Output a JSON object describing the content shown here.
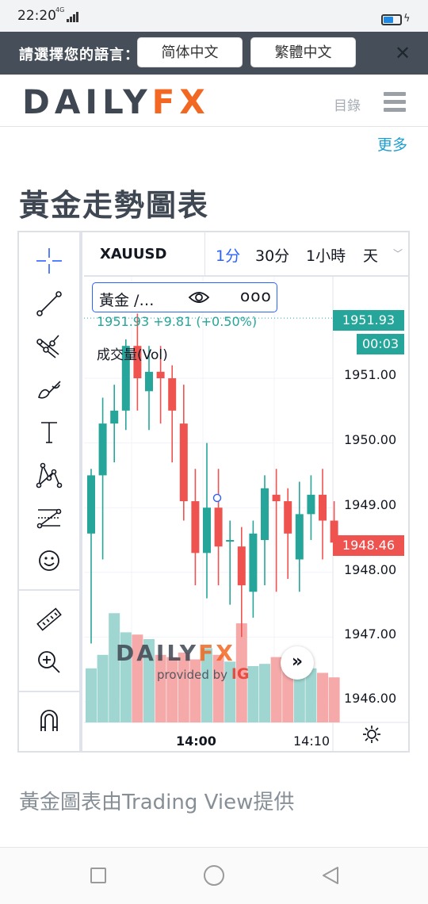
{
  "status": {
    "time": "22:20",
    "network": "4G",
    "battery_color": "#1e88e5"
  },
  "lang_bar": {
    "label": "請選擇您的語言：",
    "options": [
      "简体中文",
      "繁體中文"
    ],
    "close": "✕"
  },
  "header": {
    "logo_left": "DAILY",
    "logo_right": "FX",
    "menu_label": "目錄"
  },
  "more_link": "更多",
  "page_title": "黃金走勢圖表",
  "chart": {
    "symbol": "XAUUSD",
    "intervals": [
      "1分",
      "30分",
      "1小時",
      "天"
    ],
    "active_interval": "1分",
    "legend_name": "黃金 /…",
    "legend_dots": "ooo",
    "price_change": "1951.93  +9.81 (+0.50%)",
    "volume_label": "成交量(Vol)",
    "last_price_tag": "1951.93",
    "countdown_tag": "00:03",
    "current_price_tag": "1948.46",
    "watermark_logo_left": "DAILY",
    "watermark_logo_right": "FX",
    "watermark_sub": "provided by",
    "watermark_brand": "IG",
    "scroll_button": "»",
    "colors": {
      "up": "#26a69a",
      "down": "#ef5350",
      "vol_up": "#9fd6d1",
      "vol_down": "#f5aaa9"
    }
  },
  "chart_data": {
    "type": "candlestick",
    "title": "XAUUSD",
    "y_ticks": [
      "1951.00",
      "1950.00",
      "1949.00",
      "1948.00",
      "1947.00",
      "1946.00"
    ],
    "x_ticks": [
      "14:00",
      "14:10"
    ],
    "ylim": [
      1945.6,
      1952.4
    ],
    "candles": [
      {
        "o": 1948.6,
        "h": 1949.6,
        "l": 1946.9,
        "c": 1949.5
      },
      {
        "o": 1949.5,
        "h": 1950.7,
        "l": 1948.2,
        "c": 1950.3
      },
      {
        "o": 1950.3,
        "h": 1950.9,
        "l": 1949.7,
        "c": 1950.5
      },
      {
        "o": 1950.5,
        "h": 1951.6,
        "l": 1950.2,
        "c": 1951.5
      },
      {
        "o": 1951.5,
        "h": 1952.0,
        "l": 1950.5,
        "c": 1951.0
      },
      {
        "o": 1950.8,
        "h": 1951.5,
        "l": 1950.2,
        "c": 1951.1
      },
      {
        "o": 1951.1,
        "h": 1951.5,
        "l": 1950.3,
        "c": 1951.0
      },
      {
        "o": 1951.0,
        "h": 1951.2,
        "l": 1949.7,
        "c": 1950.5
      },
      {
        "o": 1950.3,
        "h": 1950.9,
        "l": 1948.8,
        "c": 1949.1
      },
      {
        "o": 1949.1,
        "h": 1949.6,
        "l": 1947.8,
        "c": 1948.3
      },
      {
        "o": 1948.3,
        "h": 1950.0,
        "l": 1947.6,
        "c": 1949.0
      },
      {
        "o": 1949.0,
        "h": 1949.6,
        "l": 1947.8,
        "c": 1948.4
      },
      {
        "o": 1948.5,
        "h": 1948.8,
        "l": 1947.5,
        "c": 1948.5
      },
      {
        "o": 1948.4,
        "h": 1948.7,
        "l": 1947.0,
        "c": 1947.8
      },
      {
        "o": 1947.7,
        "h": 1948.8,
        "l": 1947.3,
        "c": 1948.6
      },
      {
        "o": 1948.5,
        "h": 1949.5,
        "l": 1947.8,
        "c": 1949.3
      },
      {
        "o": 1949.2,
        "h": 1949.6,
        "l": 1947.7,
        "c": 1949.1
      },
      {
        "o": 1949.1,
        "h": 1949.3,
        "l": 1947.9,
        "c": 1948.6
      },
      {
        "o": 1948.2,
        "h": 1949.4,
        "l": 1947.7,
        "c": 1948.9
      },
      {
        "o": 1948.9,
        "h": 1949.5,
        "l": 1948.5,
        "c": 1949.2
      },
      {
        "o": 1949.2,
        "h": 1949.6,
        "l": 1948.2,
        "c": 1948.8
      },
      {
        "o": 1948.8,
        "h": 1949.1,
        "l": 1948.4,
        "c": 1948.46
      }
    ],
    "volumes": [
      48,
      60,
      97,
      80,
      78,
      74,
      60,
      58,
      62,
      56,
      66,
      60,
      54,
      88,
      50,
      52,
      58,
      47,
      46,
      48,
      44,
      40
    ]
  },
  "caption": "黃金圖表由Trading View提供"
}
